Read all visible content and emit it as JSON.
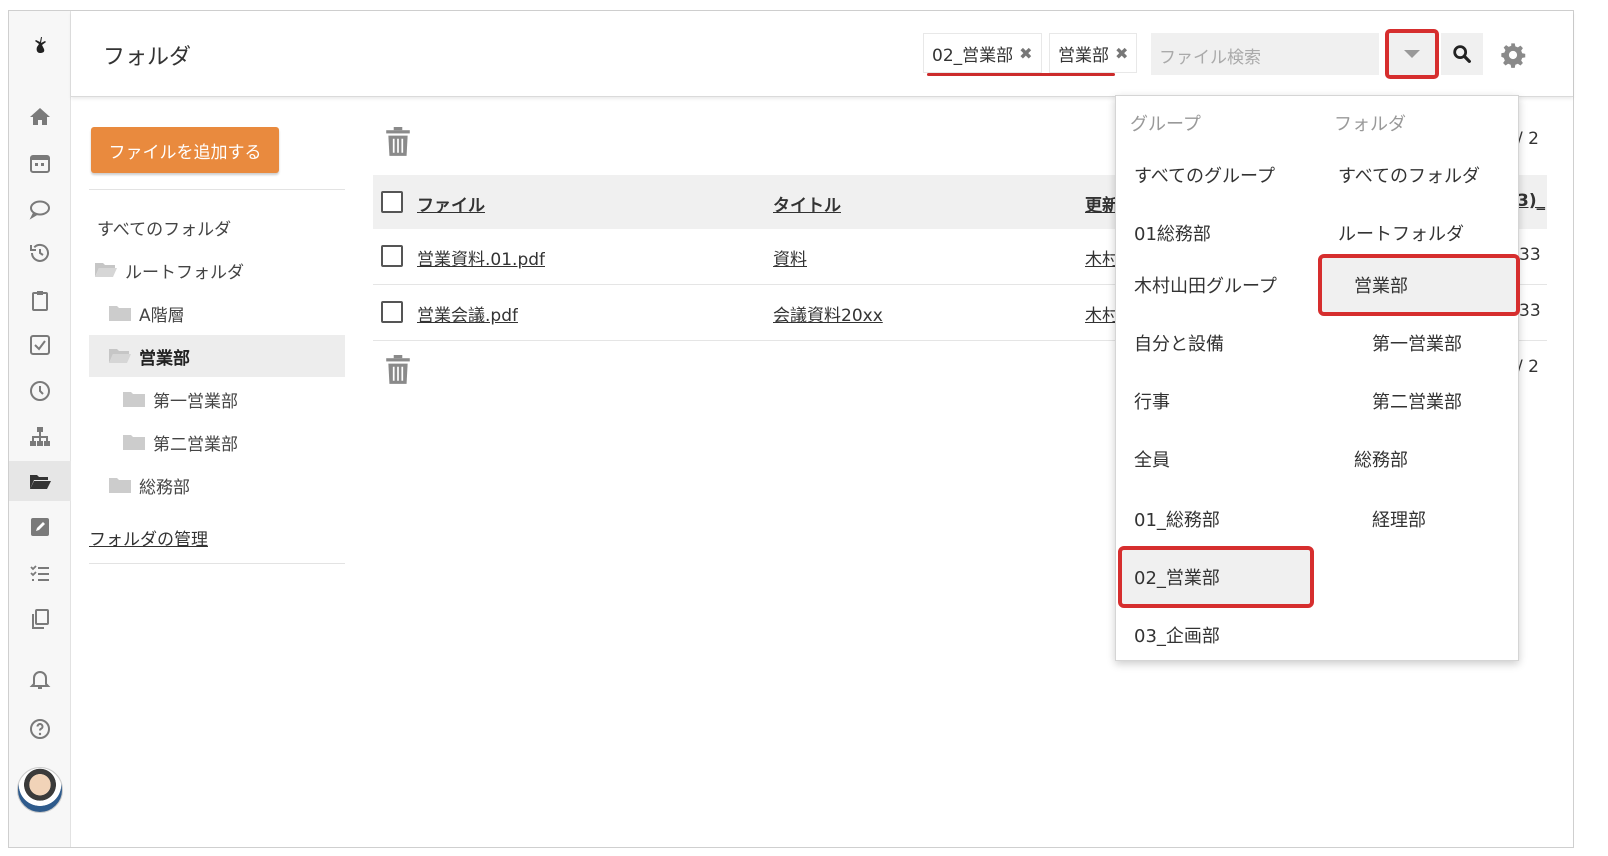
{
  "header": {
    "title": "フォルダ",
    "chips": [
      {
        "label": "02_営業部",
        "remove": "✖"
      },
      {
        "label": "営業部",
        "remove": "✖"
      }
    ],
    "search_placeholder": "ファイル検索"
  },
  "sidebar_icons": [
    "home-icon",
    "calendar-icon",
    "chat-icon",
    "history-icon",
    "clipboard-icon",
    "checkbox-icon",
    "clock-icon",
    "org-chart-icon",
    "folder-open-icon",
    "edit-icon",
    "list-icon",
    "copy-icon",
    "bell-icon",
    "help-icon"
  ],
  "folders": {
    "add_button": "ファイルを追加する",
    "all_folders": "すべてのフォルダ",
    "tree": [
      {
        "label": "ルートフォルダ",
        "level": 0
      },
      {
        "label": "A階層",
        "level": 1
      },
      {
        "label": "営業部",
        "level": 1,
        "selected": true
      },
      {
        "label": "第一営業部",
        "level": 2
      },
      {
        "label": "第二営業部",
        "level": 2
      },
      {
        "label": "総務部",
        "level": 1
      }
    ],
    "manage_link": "フォルダの管理"
  },
  "table": {
    "columns": [
      "ファイル",
      "タイトル",
      "更新"
    ],
    "rows": [
      {
        "file": "営業資料.01.pdf",
        "title": "資料",
        "updater": "木村",
        "trail": "33"
      },
      {
        "file": "営業会議.pdf",
        "title": "会議資料20xx",
        "updater": "木村",
        "trail": "33"
      }
    ],
    "pager_top": "/ 2",
    "pager_bottom": "/ 2",
    "head_trail": "3)_"
  },
  "dropdown": {
    "group_header": "グループ",
    "folder_header": "フォルダ",
    "groups": [
      "すべてのグループ",
      "01総務部",
      "木村山田グループ",
      "自分と設備",
      "行事",
      "全員",
      "01_総務部",
      "02_営業部",
      "03_企画部"
    ],
    "folders": [
      "すべてのフォルダ",
      "ルートフォルダ",
      "営業部",
      "第一営業部",
      "第二営業部",
      "総務部",
      "経理部"
    ]
  },
  "colors": {
    "accent": "#e98a3e",
    "highlight": "#d62e2e"
  }
}
